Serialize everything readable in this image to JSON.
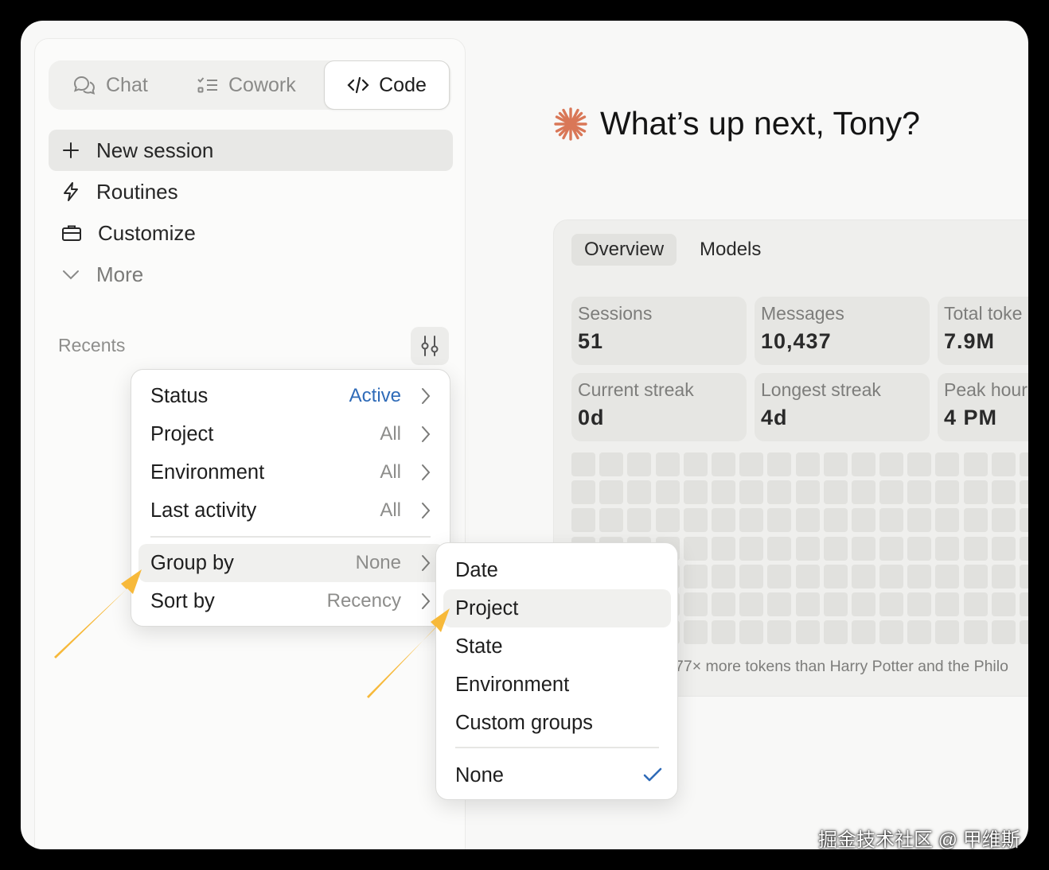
{
  "mode_tabs": [
    {
      "label": "Chat",
      "icon": "chat-icon"
    },
    {
      "label": "Cowork",
      "icon": "checklist-icon"
    },
    {
      "label": "Code",
      "icon": "code-icon",
      "active": true
    }
  ],
  "nav": {
    "new_session": "New session",
    "routines": "Routines",
    "customize": "Customize",
    "more": "More"
  },
  "recents": {
    "label": "Recents",
    "filter_icon": "sliders-icon"
  },
  "greeting": "What’s up next, Tony?",
  "stats": {
    "tabs": [
      "Overview",
      "Models"
    ],
    "cards": [
      {
        "label": "Sessions",
        "value": "51"
      },
      {
        "label": "Messages",
        "value": "10,437"
      },
      {
        "label": "Total toke",
        "value": "7.9M"
      },
      {
        "label": "Current streak",
        "value": "0d"
      },
      {
        "label": "Longest streak",
        "value": "4d"
      },
      {
        "label": "Peak hour",
        "value": "4 PM"
      }
    ],
    "footer": "77× more tokens than Harry Potter and the Philo"
  },
  "filter_menu": {
    "items": [
      {
        "label": "Status",
        "value": "Active"
      },
      {
        "label": "Project",
        "value": "All"
      },
      {
        "label": "Environment",
        "value": "All"
      },
      {
        "label": "Last activity",
        "value": "All"
      },
      {
        "label": "Group by",
        "value": "None"
      },
      {
        "label": "Sort by",
        "value": "Recency"
      }
    ]
  },
  "group_menu": {
    "items": [
      "Date",
      "Project",
      "State",
      "Environment",
      "Custom groups"
    ],
    "none_label": "None"
  },
  "colors": {
    "accent": "#2f6bb8",
    "brand": "#d97757",
    "annotation_arrow": "#f7b93a"
  },
  "watermark": "掘金技术社区 @ 甲维斯"
}
